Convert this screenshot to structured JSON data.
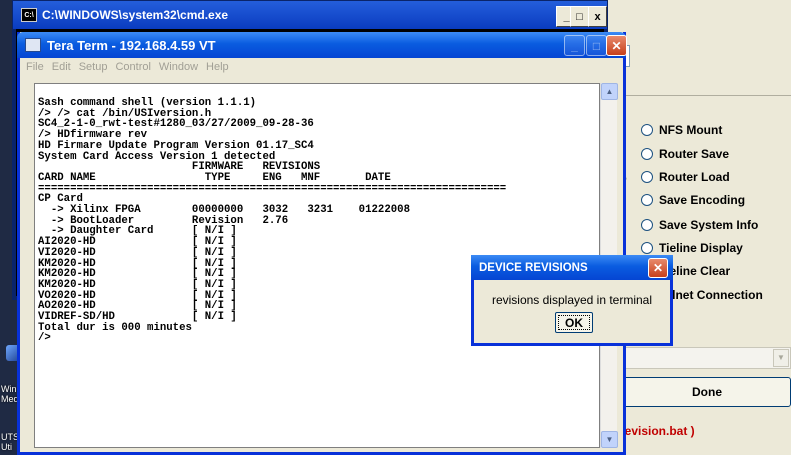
{
  "desktop": {
    "labels": [
      "Win",
      "Media",
      "UTSCI",
      "Uti"
    ]
  },
  "right_app": {
    "cut_labels": [
      "g",
      "l",
      "nfo",
      "y"
    ],
    "radios": [
      "NFS Mount",
      "Router Save",
      "Router Load",
      "Save Encoding",
      "Save System Info",
      "Tieline Display",
      "Tieline Clear",
      "Telnet Connection"
    ],
    "done_label": "Done",
    "status": "trevision.bat )",
    "status_color": "#c00000"
  },
  "cmd_window": {
    "title": "C:\\WINDOWS\\system32\\cmd.exe",
    "icon": "cmd-icon",
    "side_text": [
      "C:",
      "US"
    ],
    "buttons": {
      "minimize": "_",
      "maximize": "□",
      "close": "x"
    }
  },
  "teraterm": {
    "title": "Tera Term - 192.168.4.59 VT",
    "menu": [
      "File",
      "Edit",
      "Setup",
      "Control",
      "Window",
      "Help"
    ],
    "terminal_lines": [
      "Sash command shell (version 1.1.1)",
      "/> /> cat /bin/USIversion.h",
      "SC4_2-1-0_rwt-test#1280_03/27/2009_09-28-36",
      "/> HDfirmware rev",
      "HD Firmare Update Program Version 01.17_SC4",
      "System Card Access Version 1 detected",
      "                        FIRMWARE   REVISIONS",
      "CARD NAME                 TYPE     ENG   MNF       DATE",
      "=========================================================================",
      "CP Card",
      "  -> Xilinx FPGA        00000000   3032   3231    01222008",
      "  -> BootLoader         Revision   2.76",
      "  -> Daughter Card      [ N/I ]",
      "AI2020-HD               [ N/I ]",
      "VI2020-HD               [ N/I ]",
      "KM2020-HD               [ N/I ]",
      "KM2020-HD               [ N/I ]",
      "KM2020-HD               [ N/I ]",
      "VO2020-HD               [ N/I ]",
      "AO2020-HD               [ N/I ]",
      "VIDREF-SD/HD            [ N/I ]",
      "Total dur is 000 minutes",
      "/>"
    ]
  },
  "dialog": {
    "title": "DEVICE REVISIONS",
    "message": "revisions displayed in terminal",
    "ok_label": "OK"
  }
}
